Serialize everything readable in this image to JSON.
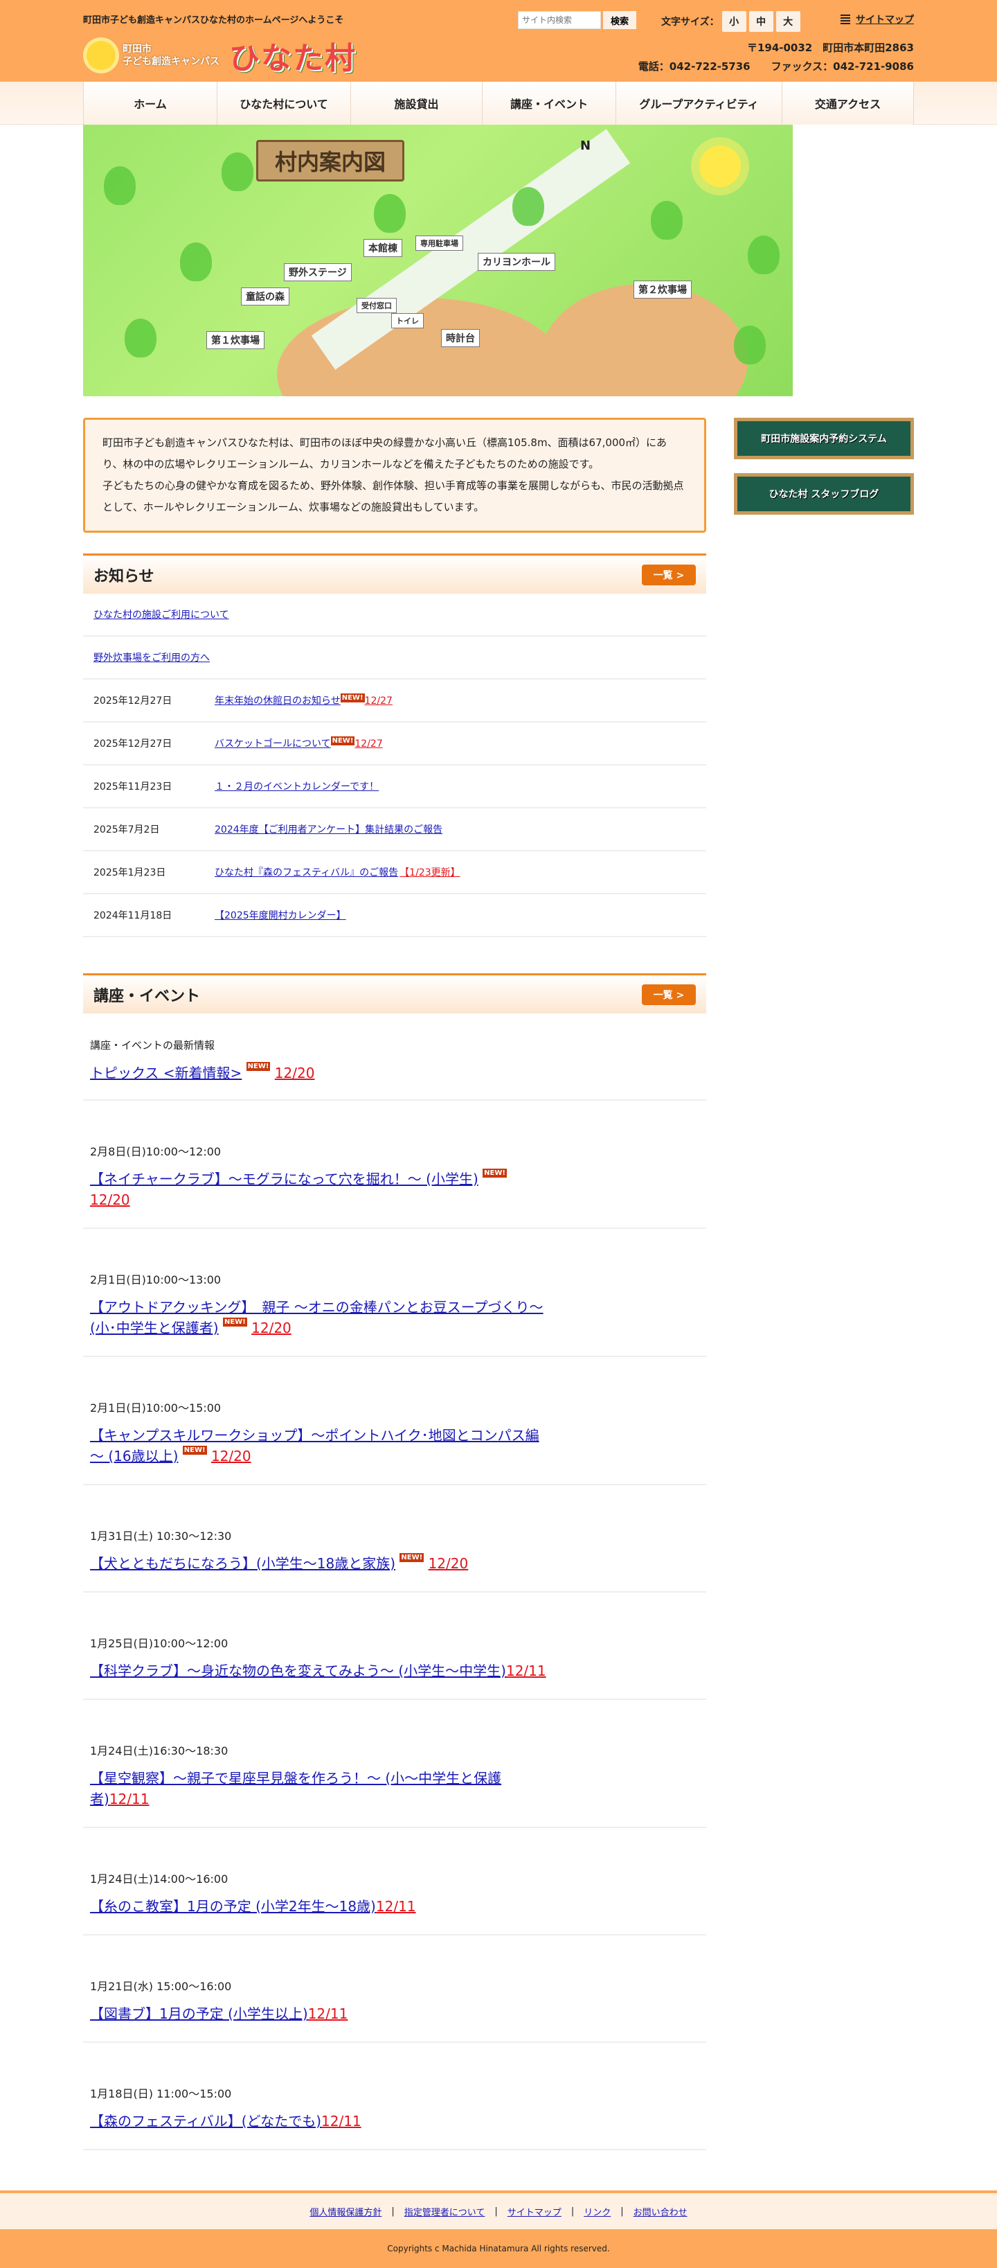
{
  "header": {
    "welcome": "町田市子ども創造キャンパスひなた村のホームページへようこそ",
    "search_placeholder": "サイト内検索",
    "search_button": "検索",
    "font_size_label": "文字サイズ：",
    "font_sizes": [
      "小",
      "中",
      "大"
    ],
    "sitemap": "サイトマップ",
    "logo_line1": "町田市",
    "logo_line2": "子ども創造キャンパス",
    "logo_main": "ひなた村",
    "address": "〒194-0032　町田市本町田2863",
    "phone": "電話：042-722-5736",
    "fax": "ファックス：042-721-9086"
  },
  "nav": [
    "ホーム",
    "ひなた村について",
    "施設貸出",
    "講座・イベント",
    "グループアクティビティ",
    "交通アクセス"
  ],
  "hero": {
    "title": "村内案内図",
    "north": "N",
    "labels": [
      "本館棟",
      "専用駐車場",
      "カリヨンホール",
      "野外ステージ",
      "童話の森",
      "受付窓口",
      "トイレ",
      "第１炊事場",
      "時計台",
      "第２炊事場"
    ]
  },
  "intro": {
    "p1": "町田市子ども創造キャンパスひなた村は、町田市のほぼ中央の緑豊かな小高い丘（標高105.8m、面積は67,000㎡）にあり、林の中の広場やレクリエーションルーム、カリヨンホールなどを備えた子どもたちのための施設です。",
    "p2": "子どもたちの心身の健やかな育成を図るため、野外体験、創作体験、担い手育成等の事業を展開しながらも、市民の活動拠点として、ホールやレクリエーションルーム、炊事場などの施設貸出もしています。"
  },
  "side": {
    "banner1": "町田市施設案内予約システム",
    "banner2": "ひなた村 スタッフブログ"
  },
  "news": {
    "title": "お知らせ",
    "more": "一覧 >",
    "new_label": "NEW!",
    "items": [
      {
        "date": "",
        "title": "ひなた村の施設ご利用について",
        "new": false,
        "badge": ""
      },
      {
        "date": "",
        "title": "野外炊事場をご利用の方へ",
        "new": false,
        "badge": ""
      },
      {
        "date": "2025年12月27日",
        "title": "年末年始の休館日のお知らせ",
        "new": true,
        "badge": "12/27"
      },
      {
        "date": "2025年12月27日",
        "title": "バスケットゴールについて",
        "new": true,
        "badge": "12/27"
      },
      {
        "date": "2025年11月23日",
        "title": "１・２月のイベントカレンダーです！",
        "new": false,
        "badge": ""
      },
      {
        "date": "2025年7月2日",
        "title": "2024年度【ご利用者アンケート】集計結果のご報告",
        "new": false,
        "badge": ""
      },
      {
        "date": "2025年1月23日",
        "title": "ひなた村『森のフェスティバル』のご報告",
        "new": false,
        "badge": "【1/23更新】"
      },
      {
        "date": "2024年11月18日",
        "title": "【2025年度開村カレンダー】",
        "new": false,
        "badge": ""
      }
    ]
  },
  "events": {
    "title": "講座・イベント",
    "more": "一覧 >",
    "caption": "講座・イベントの最新情報",
    "topics": {
      "title": "トピックス <新着情報>",
      "new": true,
      "badge": "12/20"
    },
    "new_label": "NEW!",
    "items": [
      {
        "date": "2月8日(日)10:00～12:00",
        "title": "【ネイチャークラブ】～モグラになって穴を掘れ！～ (小学生)",
        "new": true,
        "badge": "12/20"
      },
      {
        "date": "2月1日(日)10:00～13:00",
        "title": "【アウトドアクッキング】　親子 ～オニの金棒パンとお豆スープづくり～ (小･中学生と保護者)",
        "new": true,
        "badge": "12/20"
      },
      {
        "date": "2月1日(日)10:00～15:00",
        "title": "【キャンプスキルワークショップ】～ポイントハイク･地図とコンパス編～ (16歳以上)",
        "new": true,
        "badge": "12/20"
      },
      {
        "date": "1月31日(土) 10:30～12:30",
        "title": "【犬とともだちになろう】(小学生～18歳と家族)",
        "new": true,
        "badge": "12/20"
      },
      {
        "date": "1月25日(日)10:00～12:00",
        "title": "【科学クラブ】～身近な物の色を変えてみよう～ (小学生～中学生)",
        "new": false,
        "badge": "12/11"
      },
      {
        "date": "1月24日(土)16:30～18:30",
        "title": "【星空観察】～親子で星座早見盤を作ろう！～ (小～中学生と保護者)",
        "new": false,
        "badge": "12/11"
      },
      {
        "date": "1月24日(土)14:00～16:00",
        "title": "【糸のこ教室】1月の予定 (小学2年生～18歳)",
        "new": false,
        "badge": "12/11"
      },
      {
        "date": "1月21日(水) 15:00～16:00",
        "title": "【図書ブ】1月の予定 (小学生以上)",
        "new": false,
        "badge": "12/11"
      },
      {
        "date": "1月18日(日) 11:00～15:00",
        "title": "【森のフェスティバル】(どなたでも)",
        "new": false,
        "badge": "12/11"
      }
    ]
  },
  "footer": {
    "links": [
      "個人情報保護方針",
      "指定管理者について",
      "サイトマップ",
      "リンク",
      "お問い合わせ"
    ],
    "separator": "|",
    "copyright": "Copyrights c Machida Hinatamura All rights reserved."
  }
}
